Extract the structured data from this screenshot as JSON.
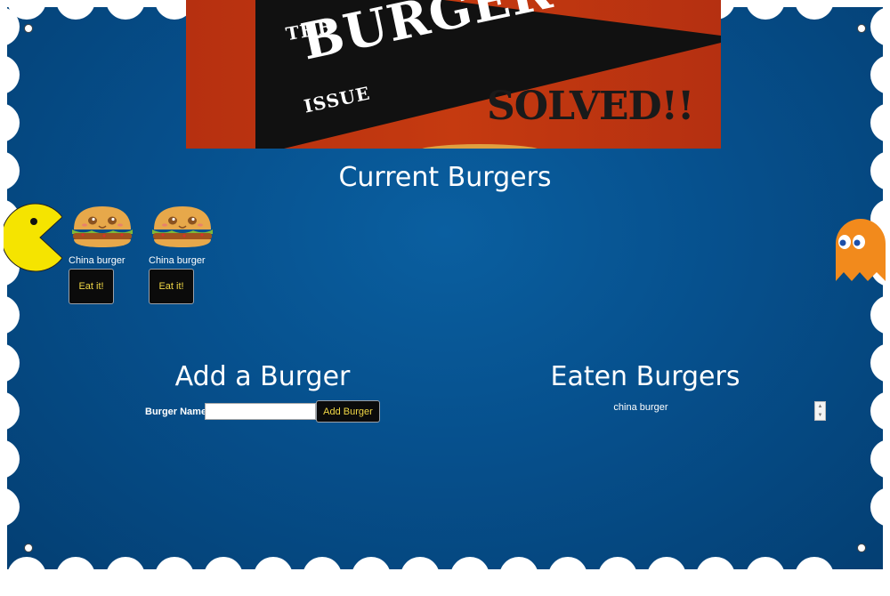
{
  "banner": {
    "the": "THE",
    "burger": "BURGER",
    "issue": "ISSUE",
    "solved": "SOLVED!!"
  },
  "current": {
    "title": "Current Burgers",
    "burgers": [
      {
        "name": "China burger",
        "button": "Eat it!"
      },
      {
        "name": "China burger",
        "button": "Eat it!"
      }
    ]
  },
  "add": {
    "title": "Add a Burger",
    "name_label": "Burger Name:",
    "input_value": "",
    "button": "Add Burger"
  },
  "eaten": {
    "title": "Eaten Burgers",
    "items": [
      "china burger"
    ]
  },
  "colors": {
    "background": "#06508d",
    "button_bg": "#0b0b0b",
    "button_text": "#f2d846",
    "banner_red": "#c53a10",
    "pacman": "#f5e400",
    "ghost": "#f28a1c"
  },
  "icons": [
    "pacman-icon",
    "ghost-icon",
    "burger-icon"
  ]
}
